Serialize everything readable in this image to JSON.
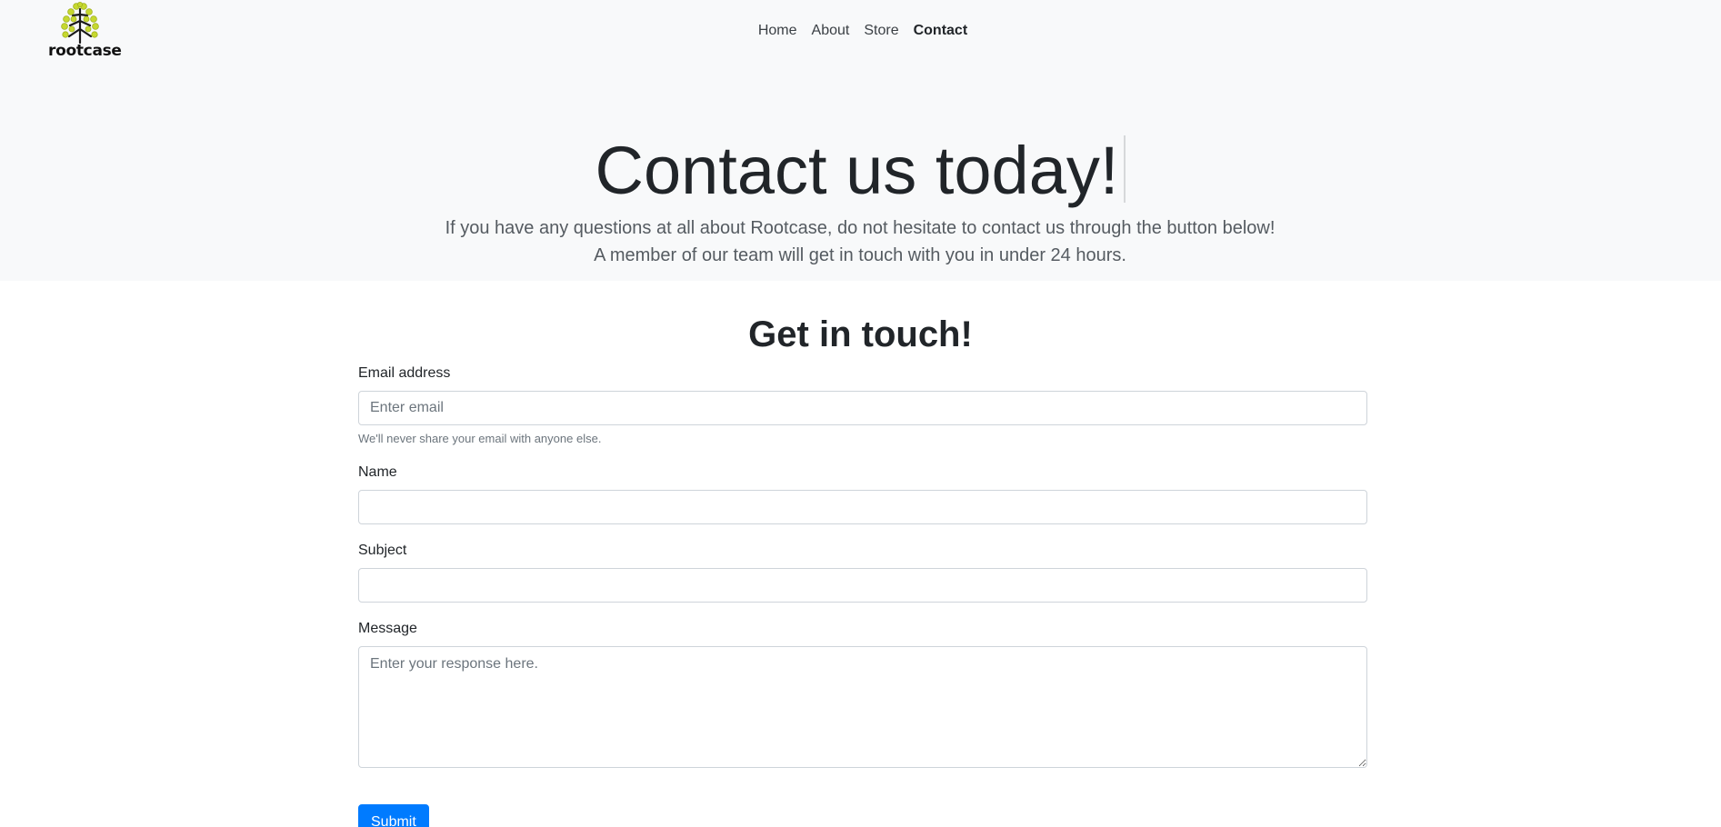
{
  "brand": {
    "name": "rootcase",
    "leaf_color": "#c6d82f",
    "trunk_color": "#1a1a1a"
  },
  "nav": {
    "items": [
      {
        "label": "Home"
      },
      {
        "label": "About"
      },
      {
        "label": "Store"
      },
      {
        "label": "Contact",
        "active": true
      }
    ]
  },
  "hero": {
    "title": "Contact us today!",
    "lead": "If you have any questions at all about Rootcase, do not hesitate to contact us through the button below! A member of our team will get in touch with you in under 24 hours."
  },
  "form": {
    "title": "Get in touch!",
    "email_label": "Email address",
    "email_placeholder": "Enter email",
    "email_help": "We'll never share your email with anyone else.",
    "name_label": "Name",
    "subject_label": "Subject",
    "message_label": "Message",
    "message_placeholder": "Enter your response here.",
    "submit_label": "Submit",
    "submit_color": "#007bff"
  }
}
